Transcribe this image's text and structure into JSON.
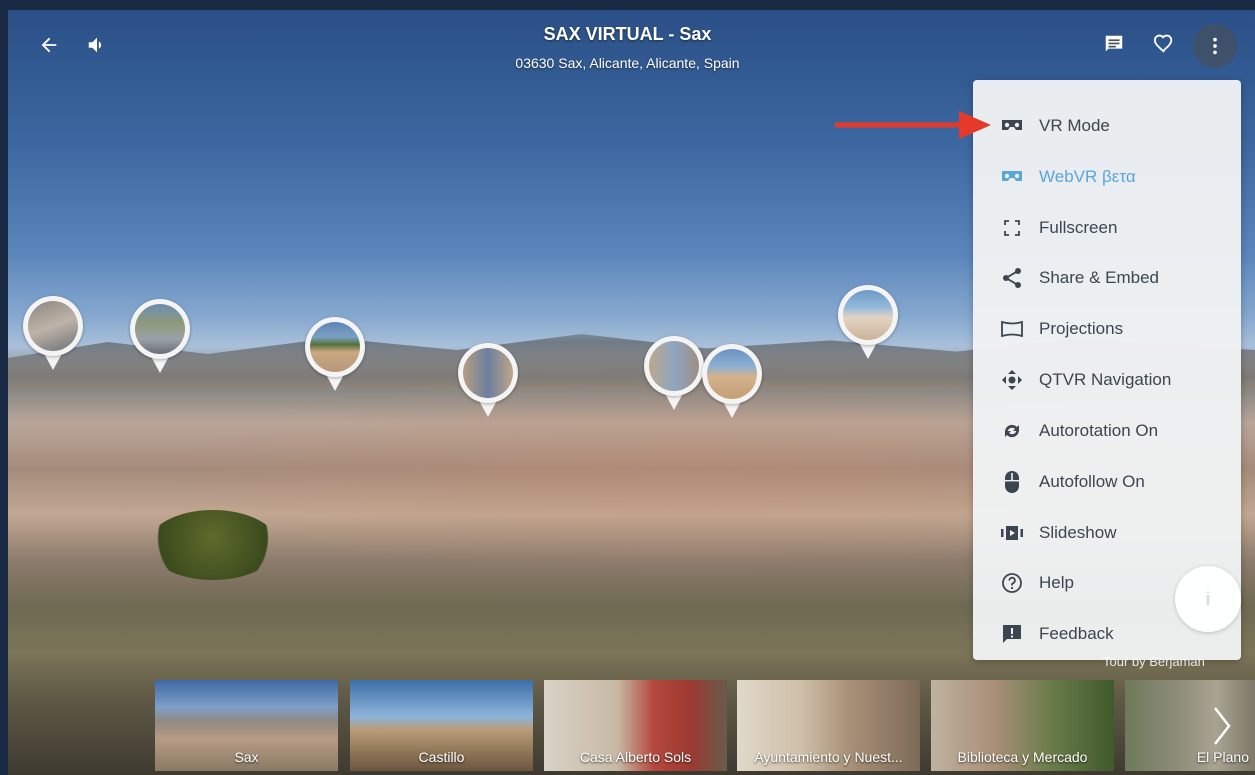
{
  "header": {
    "title": "SAX VIRTUAL - Sax",
    "subtitle": "03630 Sax, Alicante, Alicante, Spain",
    "back_icon": "arrow-left-icon",
    "sound_icon": "speaker-icon",
    "comments_icon": "comment-icon",
    "like_icon": "heart-icon",
    "more_icon": "kebab-menu-icon"
  },
  "menu": {
    "items": [
      {
        "label": "VR Mode",
        "icon": "vr-goggles-icon"
      },
      {
        "label": "WebVR βετα",
        "icon": "webvr-goggles-icon"
      },
      {
        "label": "Fullscreen",
        "icon": "fullscreen-icon"
      },
      {
        "label": "Share & Embed",
        "icon": "share-icon"
      },
      {
        "label": "Projections",
        "icon": "projections-icon"
      },
      {
        "label": "QTVR Navigation",
        "icon": "qtvr-navigation-icon"
      },
      {
        "label": "Autorotation On",
        "icon": "autorotation-icon"
      },
      {
        "label": "Autofollow On",
        "icon": "mouse-icon"
      },
      {
        "label": "Slideshow",
        "icon": "slideshow-icon"
      },
      {
        "label": "Help",
        "icon": "help-icon"
      },
      {
        "label": "Feedback",
        "icon": "feedback-icon"
      }
    ],
    "accent_color": "#5aa6d9"
  },
  "info_button": {
    "label": "i"
  },
  "credit": "Tour by Berjaman",
  "thumbnails": [
    {
      "label": "Sax",
      "active": true
    },
    {
      "label": "Castillo",
      "active": false
    },
    {
      "label": "Casa Alberto Sols",
      "active": false
    },
    {
      "label": "Ayuntamiento y Nuest...",
      "active": false
    },
    {
      "label": "Biblioteca y Mercado",
      "active": false
    },
    {
      "label": "El Plano",
      "active": false
    }
  ],
  "annotation": {
    "color": "#e53a2a",
    "target": "VR Mode"
  }
}
